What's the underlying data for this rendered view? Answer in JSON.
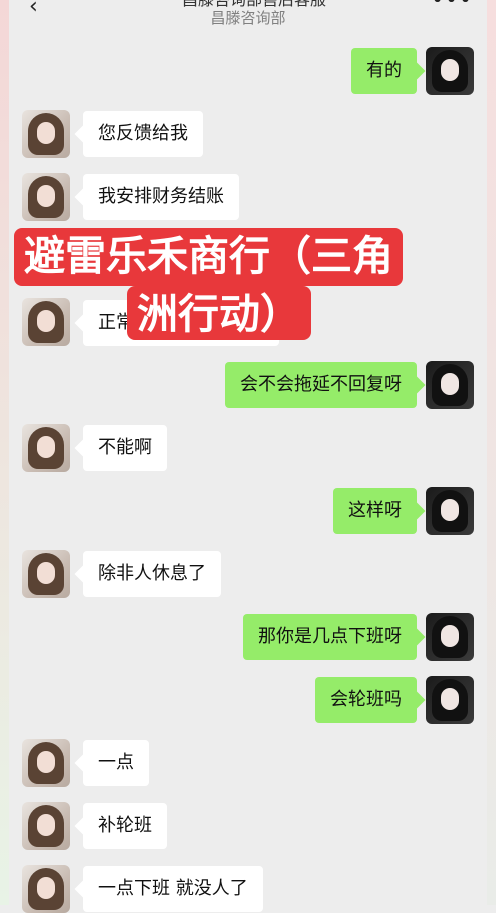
{
  "header": {
    "back_icon": "chevron-left-icon",
    "title": "昌滕咨询部售后客服",
    "subtitle": "昌滕咨询部",
    "more_icon": "more-dots-icon"
  },
  "overlay": {
    "line1": "避雷乐禾商行（三角",
    "line2": "洲行动）"
  },
  "messages": [
    {
      "side": "out",
      "text": "有的"
    },
    {
      "side": "in",
      "text": "您反馈给我"
    },
    {
      "side": "in",
      "text": "我安排财务结账"
    },
    {
      "side": "in",
      "text": "正常"
    },
    {
      "side": "out",
      "text": "会不会拖延不回复呀"
    },
    {
      "side": "in",
      "text": "不能啊"
    },
    {
      "side": "out",
      "text": "这样呀"
    },
    {
      "side": "in",
      "text": "除非人休息了"
    },
    {
      "side": "out",
      "text": "那你是几点下班呀"
    },
    {
      "side": "out",
      "text": "会轮班吗"
    },
    {
      "side": "in",
      "text": "一点"
    },
    {
      "side": "in",
      "text": "补轮班"
    },
    {
      "side": "in",
      "text": "一点下班 就没人了"
    }
  ],
  "colors": {
    "outgoing_bubble": "#95ec69",
    "incoming_bubble": "#ffffff",
    "banner": "#e8383b",
    "background": "#ededed"
  }
}
